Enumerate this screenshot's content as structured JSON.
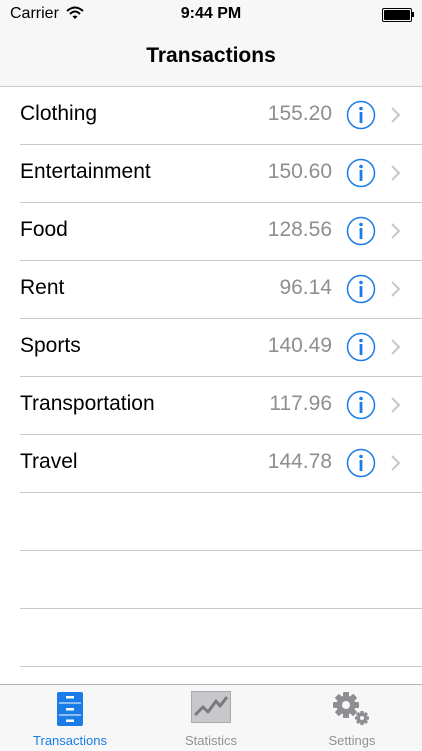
{
  "status_bar": {
    "carrier": "Carrier",
    "time": "9:44 PM",
    "battery_level": 1.0
  },
  "nav": {
    "title": "Transactions"
  },
  "transactions": [
    {
      "category": "Clothing",
      "amount": "155.20"
    },
    {
      "category": "Entertainment",
      "amount": "150.60"
    },
    {
      "category": "Food",
      "amount": "128.56"
    },
    {
      "category": "Rent",
      "amount": "96.14"
    },
    {
      "category": "Sports",
      "amount": "140.49"
    },
    {
      "category": "Transportation",
      "amount": "117.96"
    },
    {
      "category": "Travel",
      "amount": "144.78"
    }
  ],
  "tab_bar": {
    "tabs": [
      {
        "label": "Transactions",
        "icon": "filing-cabinet-icon",
        "active": true
      },
      {
        "label": "Statistics",
        "icon": "line-chart-icon",
        "active": false
      },
      {
        "label": "Settings",
        "icon": "gear-icon",
        "active": false
      }
    ]
  },
  "colors": {
    "accent": "#1a7ce6",
    "secondary_text": "#8e8e93",
    "separator": "#c8c7cc",
    "bar_background": "#f7f7f8"
  }
}
